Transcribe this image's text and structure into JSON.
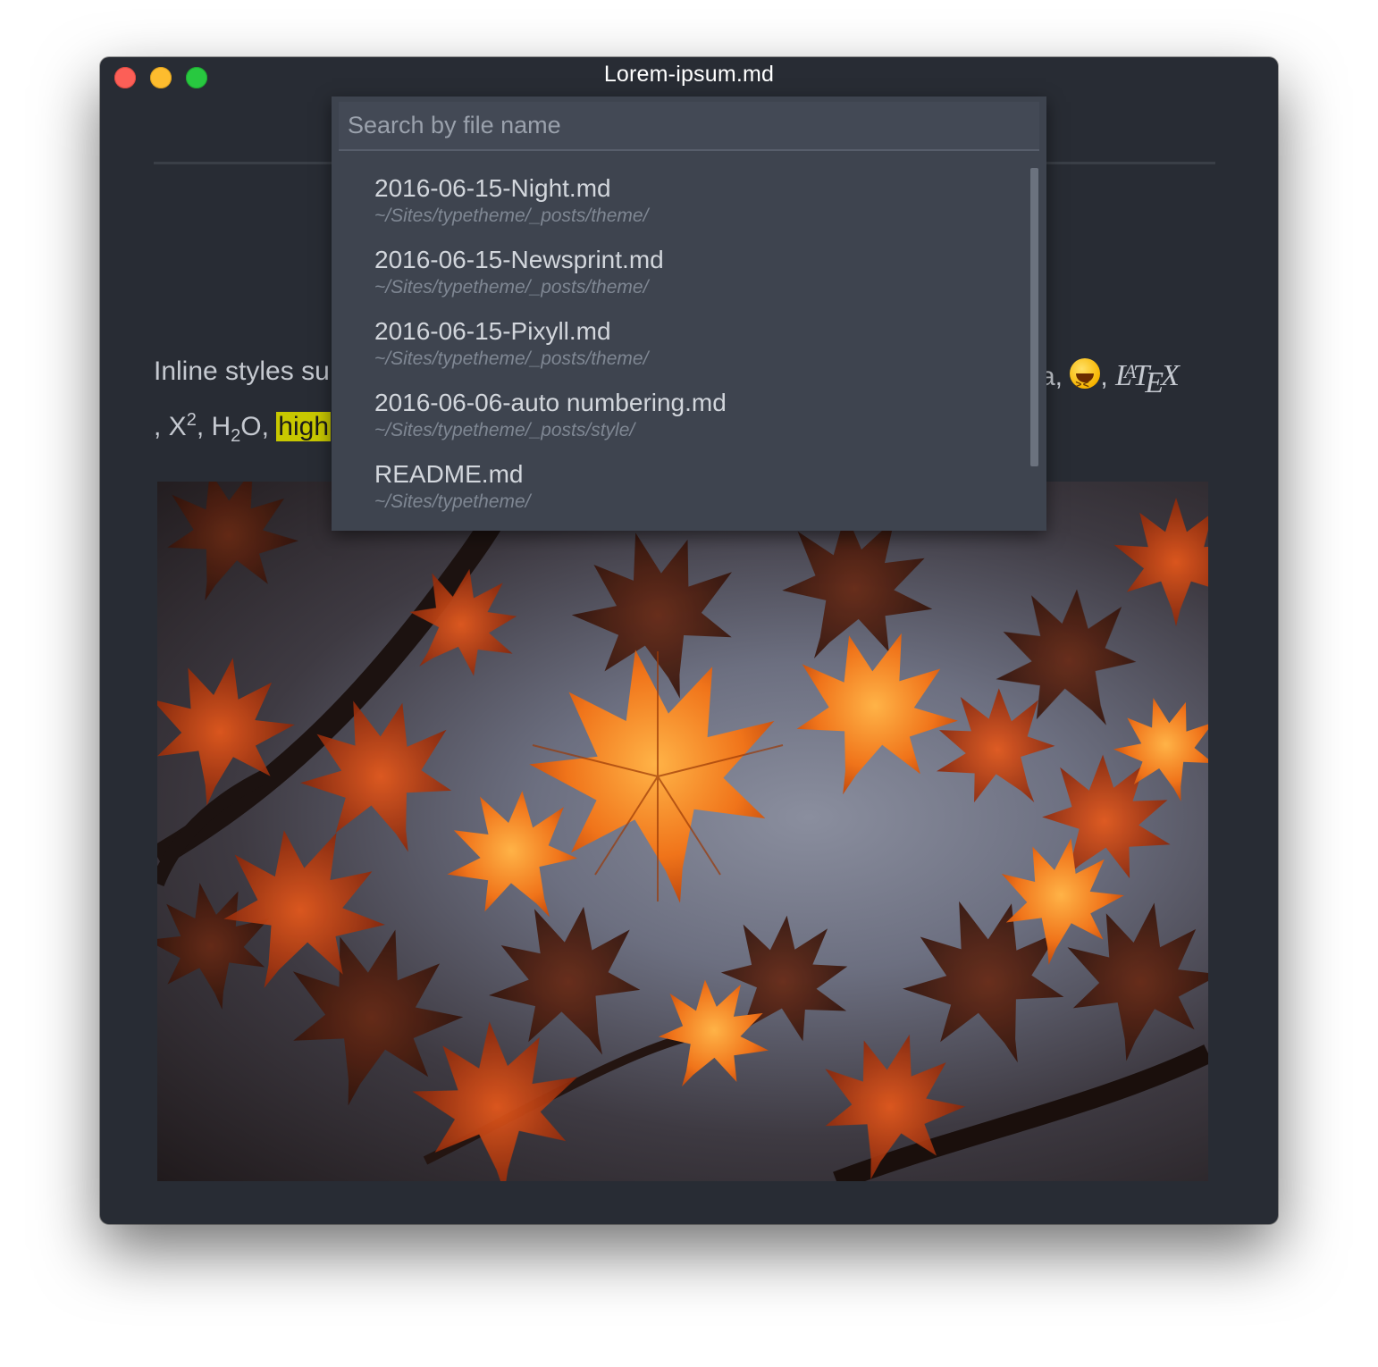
{
  "window": {
    "title": "Lorem-ipsum.md"
  },
  "document": {
    "line1_left": "Inline styles su",
    "line1_right_prefix": "a,",
    "line1_right_suffix": ",",
    "latex": {
      "l": "L",
      "a": "A",
      "t": "T",
      "e": "E",
      "x": "X"
    },
    "line2_prefix": ", X",
    "sup": "2",
    "line2_mid1": ", H",
    "sub": "2",
    "line2_mid2": "O, ",
    "highlight": "high",
    "emoji": "laughing-emoji"
  },
  "quick_open": {
    "placeholder": "Search by file name",
    "results": [
      {
        "name": "2016-06-15-Night.md",
        "path": "~/Sites/typetheme/_posts/theme/"
      },
      {
        "name": "2016-06-15-Newsprint.md",
        "path": "~/Sites/typetheme/_posts/theme/"
      },
      {
        "name": "2016-06-15-Pixyll.md",
        "path": "~/Sites/typetheme/_posts/theme/"
      },
      {
        "name": "2016-06-06-auto numbering.md",
        "path": "~/Sites/typetheme/_posts/style/"
      },
      {
        "name": "README.md",
        "path": "~/Sites/typetheme/"
      }
    ]
  },
  "colors": {
    "background": "#282c34",
    "popup": "#3e444f",
    "highlight": "#c8c800",
    "close": "#fc5f57",
    "minimize": "#fdbc2e",
    "maximize": "#28c840"
  }
}
